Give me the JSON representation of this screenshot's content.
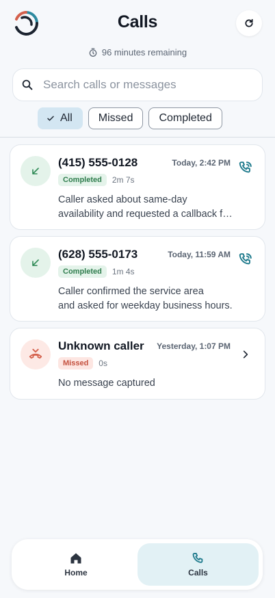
{
  "header": {
    "title": "Calls",
    "minutes_remaining": "96 minutes remaining"
  },
  "search": {
    "placeholder": "Search calls or messages",
    "value": ""
  },
  "filters": [
    {
      "label": "All",
      "selected": true
    },
    {
      "label": "Missed",
      "selected": false
    },
    {
      "label": "Completed",
      "selected": false
    }
  ],
  "calls": [
    {
      "caller": "(415) 555-0128",
      "time": "Today, 2:42 PM",
      "status": "Completed",
      "duration": "2m 7s",
      "message_line1": "Caller asked about same-day",
      "message_line2": "availability and requested a callback for the afternoon.",
      "direction_icon": "incoming-arrow-icon",
      "action_icon": "phone-callback-icon"
    },
    {
      "caller": "(628) 555-0173",
      "time": "Today, 11:59 AM",
      "status": "Completed",
      "duration": "1m 4s",
      "message_line1": "Caller confirmed the service area",
      "message_line2": "and asked for weekday business hours.",
      "direction_icon": "incoming-arrow-icon",
      "action_icon": "phone-callback-icon"
    },
    {
      "caller": "Unknown caller",
      "time": "Yesterday, 1:07 PM",
      "status": "Missed",
      "duration": "0s",
      "message_line1": "No message captured",
      "message_line2": "",
      "direction_icon": "missed-call-icon",
      "action_icon": "chevron-right-icon"
    }
  ],
  "tabbar": {
    "home_label": "Home",
    "calls_label": "Calls"
  },
  "colors": {
    "accent_teal": "#1e7a8c",
    "completed_green": "#2f7d4d",
    "missed_red": "#d4604c",
    "active_tab": "#e2f1f5",
    "active_chip": "#d3e6f2"
  }
}
